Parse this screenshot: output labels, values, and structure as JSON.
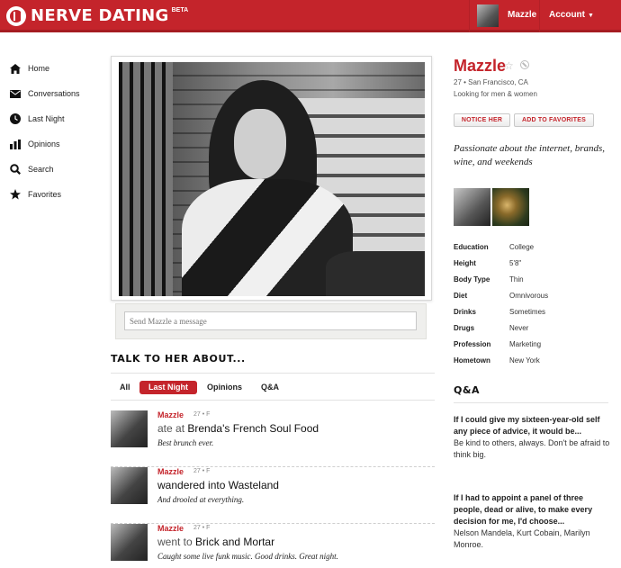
{
  "header": {
    "logo_text": "NERVE DATING",
    "beta": "BETA",
    "user_name": "Mazzle",
    "account_label": "Account",
    "brand_color": "#c4242b"
  },
  "sidebar": {
    "items": [
      {
        "label": "Home",
        "icon": "home-icon"
      },
      {
        "label": "Conversations",
        "icon": "envelope-icon"
      },
      {
        "label": "Last Night",
        "icon": "clock-icon"
      },
      {
        "label": "Opinions",
        "icon": "bar-chart-icon"
      },
      {
        "label": "Search",
        "icon": "search-icon"
      },
      {
        "label": "Favorites",
        "icon": "star-icon"
      }
    ]
  },
  "message": {
    "placeholder": "Send Mazzle a message"
  },
  "talk": {
    "title": "TALK TO HER ABOUT...",
    "tabs": [
      {
        "label": "All",
        "active": false
      },
      {
        "label": "Last Night",
        "active": true
      },
      {
        "label": "Opinions",
        "active": false
      },
      {
        "label": "Q&A",
        "active": false
      }
    ]
  },
  "feed": [
    {
      "name": "Mazzle",
      "meta": "27 • F",
      "verb": "ate at",
      "place": "Brenda's French Soul Food",
      "quote": "Best brunch ever."
    },
    {
      "name": "Mazzle",
      "meta": "27 • F",
      "verb": "",
      "place": "wandered into Wasteland",
      "quote": "And drooled at everything."
    },
    {
      "name": "Mazzle",
      "meta": "27 • F",
      "verb": "went to",
      "place": "Brick and Mortar",
      "quote": "Caught some live funk music. Good drinks. Great night."
    }
  ],
  "profile": {
    "name": "Mazzle",
    "sub": "27 •  San Francisco, CA",
    "looking": "Looking for men & women",
    "notice_label": "NOTICE HER",
    "favorite_label": "ADD TO FAVORITES",
    "tagline": "Passionate about the internet, brands, wine, and weekends",
    "details": [
      {
        "label": "Education",
        "value": "College"
      },
      {
        "label": "Height",
        "value": "5'8\""
      },
      {
        "label": "Body Type",
        "value": "Thin"
      },
      {
        "label": "Diet",
        "value": "Omnivorous"
      },
      {
        "label": "Drinks",
        "value": "Sometimes"
      },
      {
        "label": "Drugs",
        "value": "Never"
      },
      {
        "label": "Profession",
        "value": "Marketing"
      },
      {
        "label": "Hometown",
        "value": "New York"
      }
    ]
  },
  "qa": {
    "title": "Q&A",
    "items": [
      {
        "q": "If I could give my sixteen-year-old self any piece of advice, it would be...",
        "a": "Be kind to others, always. Don't be afraid to think big."
      },
      {
        "q": "If I had to appoint a panel of three people, dead or alive, to make every decision for me, I'd choose...",
        "a": "Nelson Mandela, Kurt Cobain, Marilyn Monroe."
      }
    ]
  }
}
